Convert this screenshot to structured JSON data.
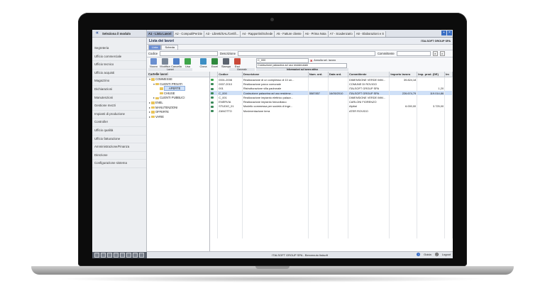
{
  "nav": {
    "header": "Seleziona il modulo",
    "items": [
      "Segreteria",
      "Ufficio commerciale",
      "Ufficio tecnico",
      "Ufficio acquisti",
      "Magazzino",
      "Dichiarazioni",
      "Manutenzioni",
      "Gestione mezzi",
      "Impianti di produzione",
      "Controller",
      "Ufficio qualità",
      "Ufficio fatturazione",
      "Amministrazione/Finanza",
      "Direzione",
      "Configurazione sistema"
    ]
  },
  "tabs": [
    "A1 - Lista Lavori",
    "A2 - Computi/Perizie",
    "A3 - Libretti/SAL/Certifi...",
    "A4 - Rapportini/Schede",
    "A5 - Fatture cliente",
    "A6 - Prima Nota",
    "A7 - Scadenzario",
    "A8 - Elaborazioni e S"
  ],
  "title": "Lista dei lavori",
  "company": "ITALSOFT GROUP SPA",
  "subtabs": [
    "Lista",
    "Scheda"
  ],
  "filters": {
    "codice": "Codice",
    "descrizione": "Descrizione",
    "committente": "Committente"
  },
  "toolbar": {
    "buttons": [
      {
        "label": "Nuovo",
        "color": "#6a8fd0"
      },
      {
        "label": "Modifica",
        "color": "#7a8798"
      },
      {
        "label": "Cancella",
        "color": "#4f7fc8"
      },
      {
        "label": "Usa",
        "color": "#3fa54a"
      },
      {
        "label": "Clona",
        "color": "#3d8fc4"
      },
      {
        "label": "Excel",
        "color": "#2f8a3e"
      },
      {
        "label": "Stampa",
        "color": "#5c6470"
      },
      {
        "label": "Esci",
        "color": "#c94a3a"
      }
    ],
    "group_lavori": "Lavori",
    "group_generale": "Generale",
    "info_code": "C_000",
    "info_action": "Annulla sel. lavoro",
    "info_desc": "Costruzione palazzina ad uso residenziale",
    "info_caption": "Informazioni sul lavoro attivo"
  },
  "tree": {
    "header": "Cartelle lavori",
    "items": [
      {
        "label": "COMMESSE",
        "level": 0,
        "tw": "▾"
      },
      {
        "label": "CLIENTI PRIVATI",
        "level": 1,
        "tw": "▾"
      },
      {
        "label": "APERTE",
        "level": 2,
        "tw": "",
        "selected": true
      },
      {
        "label": "CHIUSE",
        "level": 2,
        "tw": ""
      },
      {
        "label": "CLIENTI PUBBLICI",
        "level": 1,
        "tw": "▸"
      },
      {
        "label": "ENEL",
        "level": 0,
        "tw": "▸"
      },
      {
        "label": "MANUTENZIONI",
        "level": 0,
        "tw": "▸"
      },
      {
        "label": "OFFERTE",
        "level": 0,
        "tw": "▸"
      },
      {
        "label": "VARIE",
        "level": 0,
        "tw": "▸"
      }
    ]
  },
  "grid": {
    "columns": [
      "Codice",
      "Descrizione",
      "Num. ord.",
      "Data ord.",
      "Committente",
      "Importo lavoro",
      "Imp. prod. (DE)",
      "Im"
    ],
    "rows": [
      {
        "codice": "0001-2008",
        "descrizione": "Realizzazione di un complesso di 10 un...",
        "num": "",
        "data": "",
        "committente": "DIMENSIONE VERDE IMM...",
        "importo": "39.824,18",
        "prod": ""
      },
      {
        "codice": "0007-2010",
        "descrizione": "Realizzazione parco comunale",
        "num": "",
        "data": "",
        "committente": "COMUNE DI ROVIGO",
        "importo": "",
        "prod": ""
      },
      {
        "codice": "001",
        "descrizione": "Ristrutturazione villa padronale",
        "num": "",
        "data": "",
        "committente": "ITALSOFT GROUP SPA",
        "importo": "",
        "prod": "1,20"
      },
      {
        "codice": "C_000",
        "descrizione": "Costruzione palazzina ad uso residenz...",
        "num": "5587857",
        "data": "16/05/2010",
        "committente": "ITALSOFT GROUP SPA",
        "importo": "226.674,79",
        "prod": "119.014,86",
        "selected": true
      },
      {
        "codice": "C_001",
        "descrizione": "Realizzazione impianto elettrico palazz...",
        "num": "",
        "data": "",
        "committente": "DIMENSIONE VERDE IMM...",
        "importo": "",
        "prod": ""
      },
      {
        "codice": "ENERVIA",
        "descrizione": "Realizzazione impianto fotovoltaico",
        "num": "",
        "data": "",
        "committente": "CARLONI FIORENZO",
        "importo": "",
        "prod": ""
      },
      {
        "codice": "STUDIO_01",
        "descrizione": "Modello commessa per società di inge...",
        "num": "",
        "data": "",
        "committente": "Alpital",
        "importo": "6.000,00",
        "prod": "3.725,00"
      },
      {
        "codice": "ZANOTTO",
        "descrizione": "Movimentazione terra",
        "num": "",
        "data": "",
        "committente": "ATER ROVIGO",
        "importo": "",
        "prod": ""
      }
    ]
  },
  "status": {
    "text": "ITALSOFT GROUP SPA - Benvenuto Italsoft",
    "guide": "Guida",
    "logout": "Logout"
  }
}
